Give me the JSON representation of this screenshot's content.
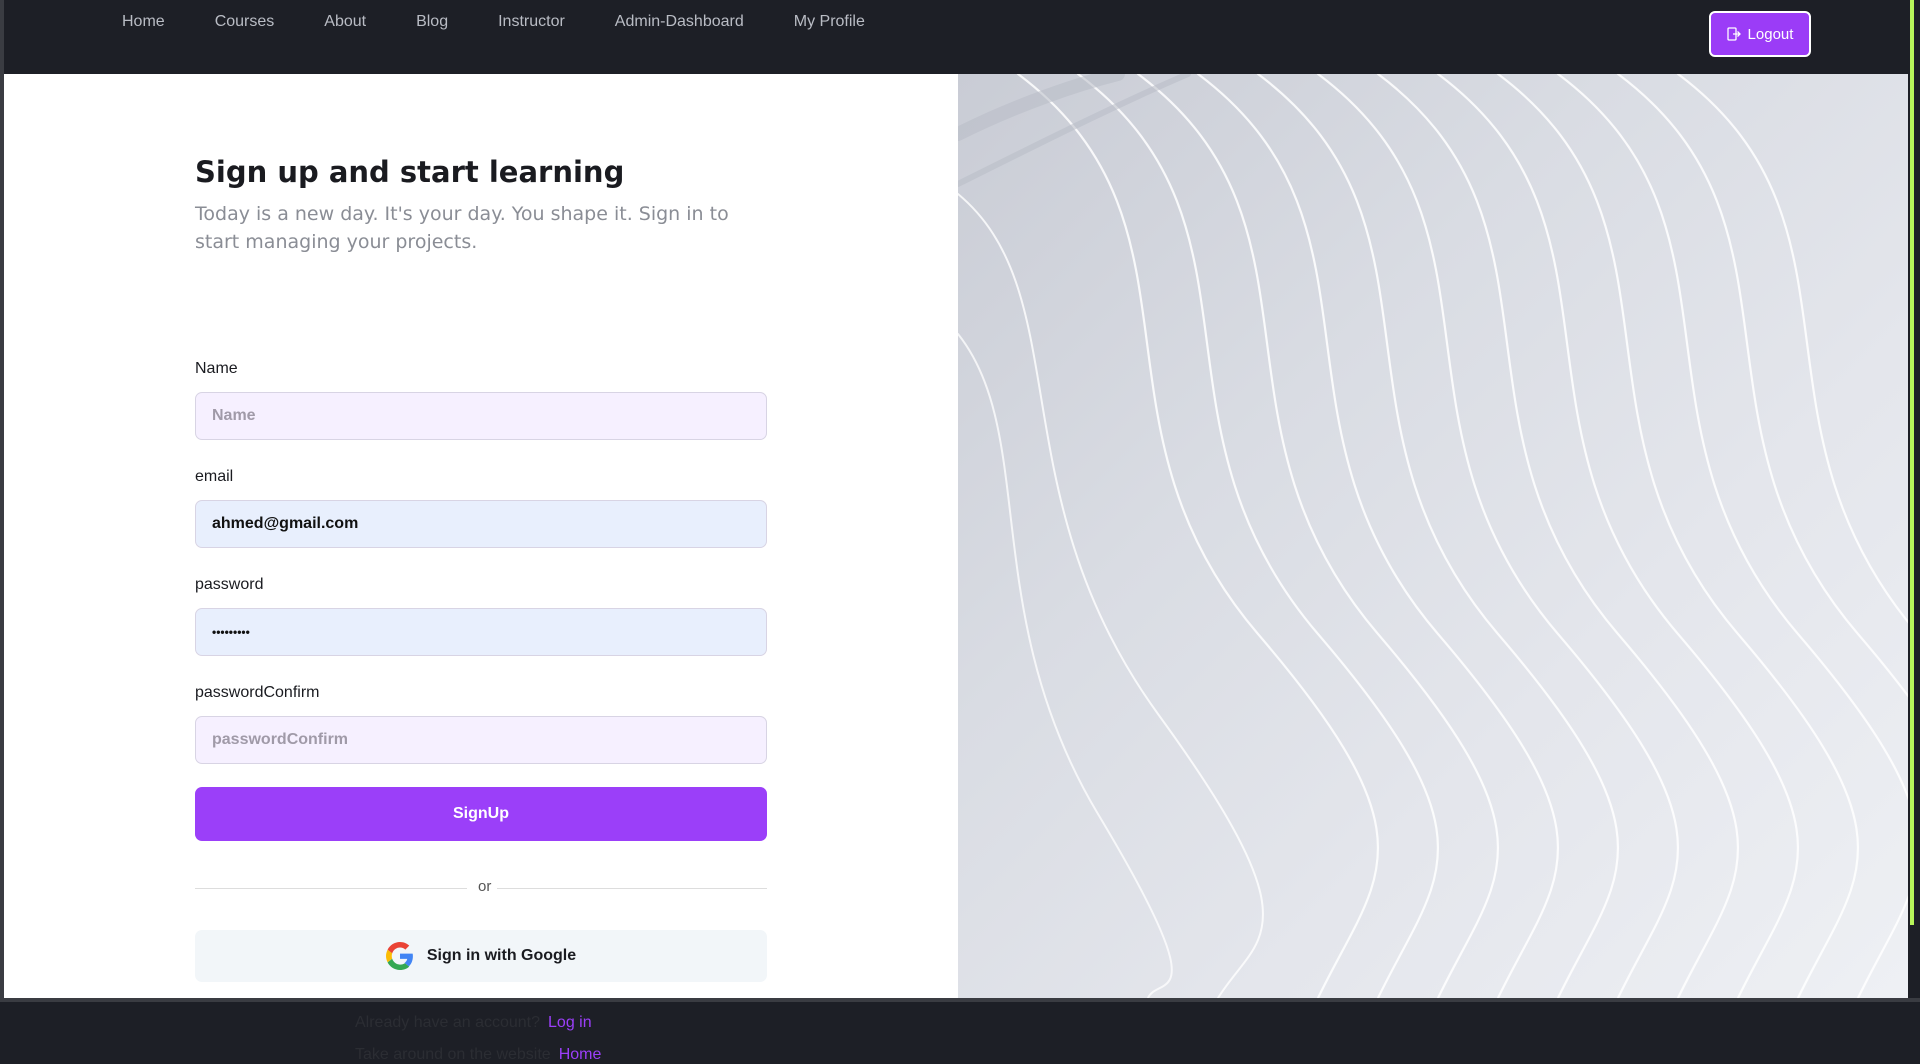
{
  "nav": {
    "links": [
      "Home",
      "Courses",
      "About",
      "Blog",
      "Instructor",
      "Admin-Dashboard",
      "My Profile"
    ],
    "logout_label": "Logout"
  },
  "form": {
    "title": "Sign up and start learning",
    "subtitle": "Today is a new day. It's your day. You shape it. Sign in to start managing your projects.",
    "name_label": "Name",
    "name_placeholder": "Name",
    "email_label": "email",
    "email_value": "ahmed@gmail.com",
    "password_label": "password",
    "password_value": "•••••••••",
    "password_confirm_label": "passwordConfirm",
    "password_confirm_placeholder": "passwordConfirm",
    "signup_label": "SignUp",
    "divider_text": "or",
    "google_label": "Sign in with Google"
  },
  "footer": {
    "login_prompt": "Already have an account?",
    "login_link": "Log in",
    "tour_prompt": "Take around on the website",
    "tour_link": "Home"
  },
  "colors": {
    "accent": "#9b3ff9",
    "nav_bg": "#1d1f26",
    "input_bg": "#f6f0ff",
    "input_filled_bg": "#e8effd"
  },
  "icons": {
    "logout": "logout-icon",
    "google": "google-g-icon"
  }
}
